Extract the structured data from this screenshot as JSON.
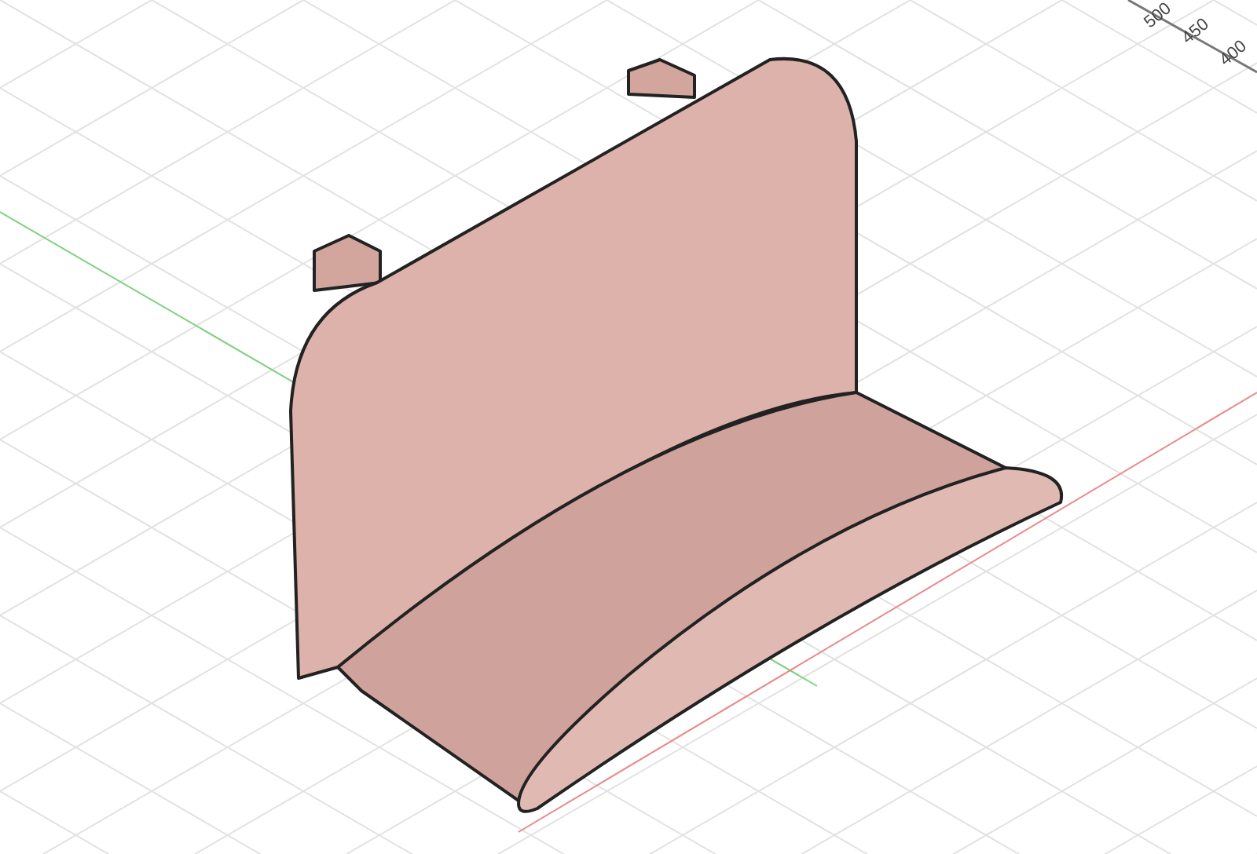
{
  "viewport": {
    "ruler_labels": [
      "500",
      "450",
      "400"
    ]
  }
}
